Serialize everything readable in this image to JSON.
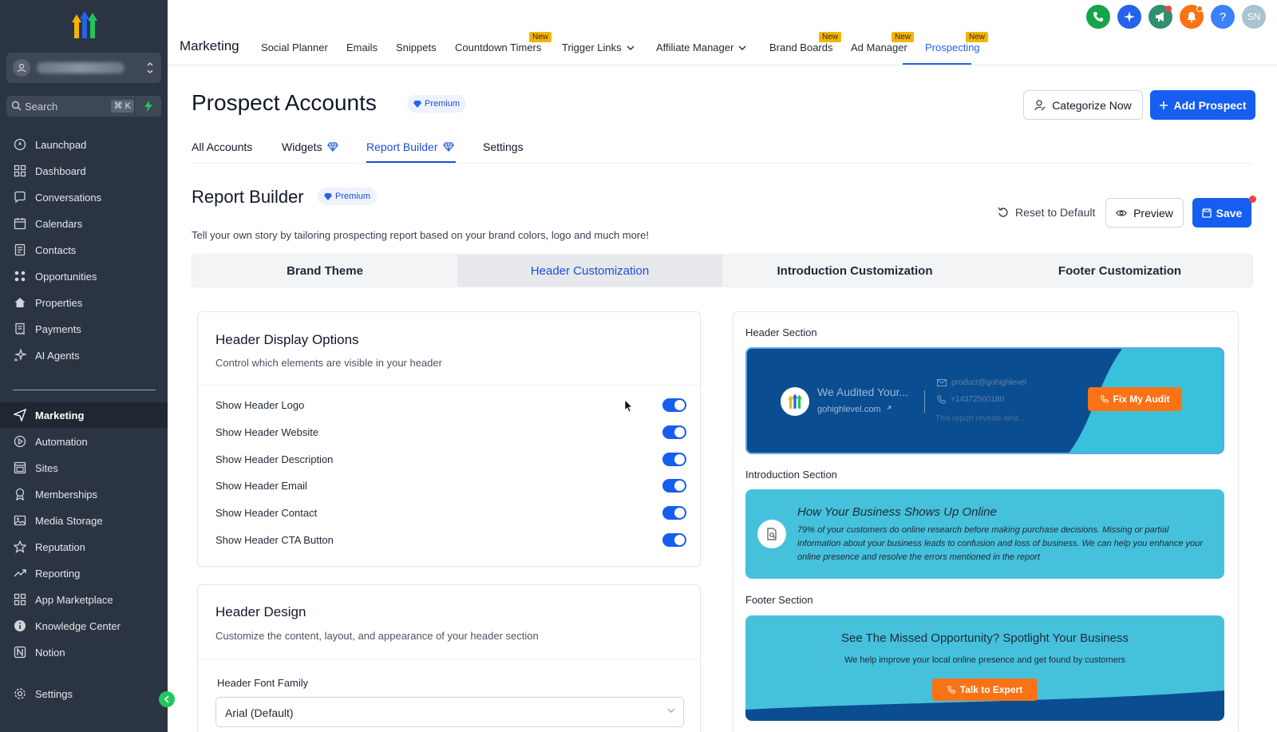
{
  "sidebar": {
    "search_label": "Search",
    "search_shortcut": "⌘ K",
    "items_top": [
      {
        "label": "Launchpad",
        "icon": "launchpad-icon"
      },
      {
        "label": "Dashboard",
        "icon": "dashboard-icon"
      },
      {
        "label": "Conversations",
        "icon": "chat-icon"
      },
      {
        "label": "Calendars",
        "icon": "calendar-icon"
      },
      {
        "label": "Contacts",
        "icon": "contacts-icon"
      },
      {
        "label": "Opportunities",
        "icon": "opportunities-icon"
      },
      {
        "label": "Properties",
        "icon": "home-icon"
      },
      {
        "label": "Payments",
        "icon": "receipt-icon"
      },
      {
        "label": "AI Agents",
        "icon": "sparkle-icon"
      }
    ],
    "items_bottom": [
      {
        "label": "Marketing",
        "icon": "send-icon",
        "active": true
      },
      {
        "label": "Automation",
        "icon": "automation-icon"
      },
      {
        "label": "Sites",
        "icon": "sites-icon"
      },
      {
        "label": "Memberships",
        "icon": "memberships-icon"
      },
      {
        "label": "Media Storage",
        "icon": "image-icon"
      },
      {
        "label": "Reputation",
        "icon": "star-icon"
      },
      {
        "label": "Reporting",
        "icon": "trend-icon"
      },
      {
        "label": "App Marketplace",
        "icon": "grid-icon"
      },
      {
        "label": "Knowledge Center",
        "icon": "info-icon"
      },
      {
        "label": "Notion",
        "icon": "notion-icon"
      }
    ],
    "settings_label": "Settings"
  },
  "topbar": {
    "section_title": "Marketing",
    "nav": [
      {
        "label": "Social Planner"
      },
      {
        "label": "Emails"
      },
      {
        "label": "Snippets"
      },
      {
        "label": "Countdown Timers",
        "badge": "New"
      },
      {
        "label": "Trigger Links",
        "dropdown": true
      },
      {
        "label": "Affiliate Manager",
        "dropdown": true
      },
      {
        "label": "Brand Boards",
        "badge": "New"
      },
      {
        "label": "Ad Manager",
        "badge": "New"
      },
      {
        "label": "Prospecting",
        "badge": "New",
        "active": true
      }
    ],
    "avatar_initials": "SN",
    "help_label": "?"
  },
  "page": {
    "title": "Prospect Accounts",
    "premium_label": "Premium",
    "categorize_label": "Categorize Now",
    "add_prospect_label": "Add Prospect",
    "subtabs": [
      {
        "label": "All Accounts"
      },
      {
        "label": "Widgets",
        "premium": true
      },
      {
        "label": "Report Builder",
        "premium": true,
        "active": true
      },
      {
        "label": "Settings"
      }
    ]
  },
  "report_builder": {
    "title": "Report Builder",
    "premium_label": "Premium",
    "description": "Tell your own story by tailoring prospecting report based on your brand colors, logo and much more!",
    "reset_label": "Reset to Default",
    "preview_label": "Preview",
    "save_label": "Save",
    "tabs": [
      {
        "label": "Brand Theme"
      },
      {
        "label": "Header Customization",
        "active": true
      },
      {
        "label": "Introduction Customization"
      },
      {
        "label": "Footer Customization"
      }
    ]
  },
  "display_options": {
    "title": "Header Display Options",
    "subtitle": "Control which elements are visible in your header",
    "toggles": [
      {
        "label": "Show Header Logo",
        "on": true
      },
      {
        "label": "Show Header Website",
        "on": true
      },
      {
        "label": "Show Header Description",
        "on": true
      },
      {
        "label": "Show Header Email",
        "on": true
      },
      {
        "label": "Show Header Contact",
        "on": true
      },
      {
        "label": "Show Header CTA Button",
        "on": true
      }
    ]
  },
  "header_design": {
    "title": "Header Design",
    "subtitle": "Customize the content, layout, and appearance of your header section",
    "font_family_label": "Header Font Family",
    "font_family_value": "Arial (Default)"
  },
  "preview": {
    "header_section_label": "Header Section",
    "header": {
      "title": "We Audited Your...",
      "website": "gohighlevel.com",
      "email": "product@gohighlevel",
      "phone": "+14372560180",
      "description": "This report reveals wha...",
      "cta": "Fix My Audit"
    },
    "intro_section_label": "Introduction Section",
    "intro": {
      "title": "How Your Business Shows Up Online",
      "body": "79% of your customers do online research before making purchase decisions. Missing or partial information about your business leads to confusion and loss of business. We can help you enhance your online presence and resolve the errors mentioned in the report"
    },
    "footer_section_label": "Footer Section",
    "footer": {
      "title": "See The Missed Opportunity? Spotlight Your Business",
      "subtitle": "We help improve your local online presence and get found by customers",
      "cta": "Talk to Expert"
    }
  },
  "colors": {
    "sidebar_bg": "#2b3442",
    "primary": "#155eef",
    "header_preview_bg": "#0a4d91",
    "section_preview_bg": "#45c1dc",
    "cta_orange": "#f97316",
    "new_badge": "#f5b400"
  }
}
